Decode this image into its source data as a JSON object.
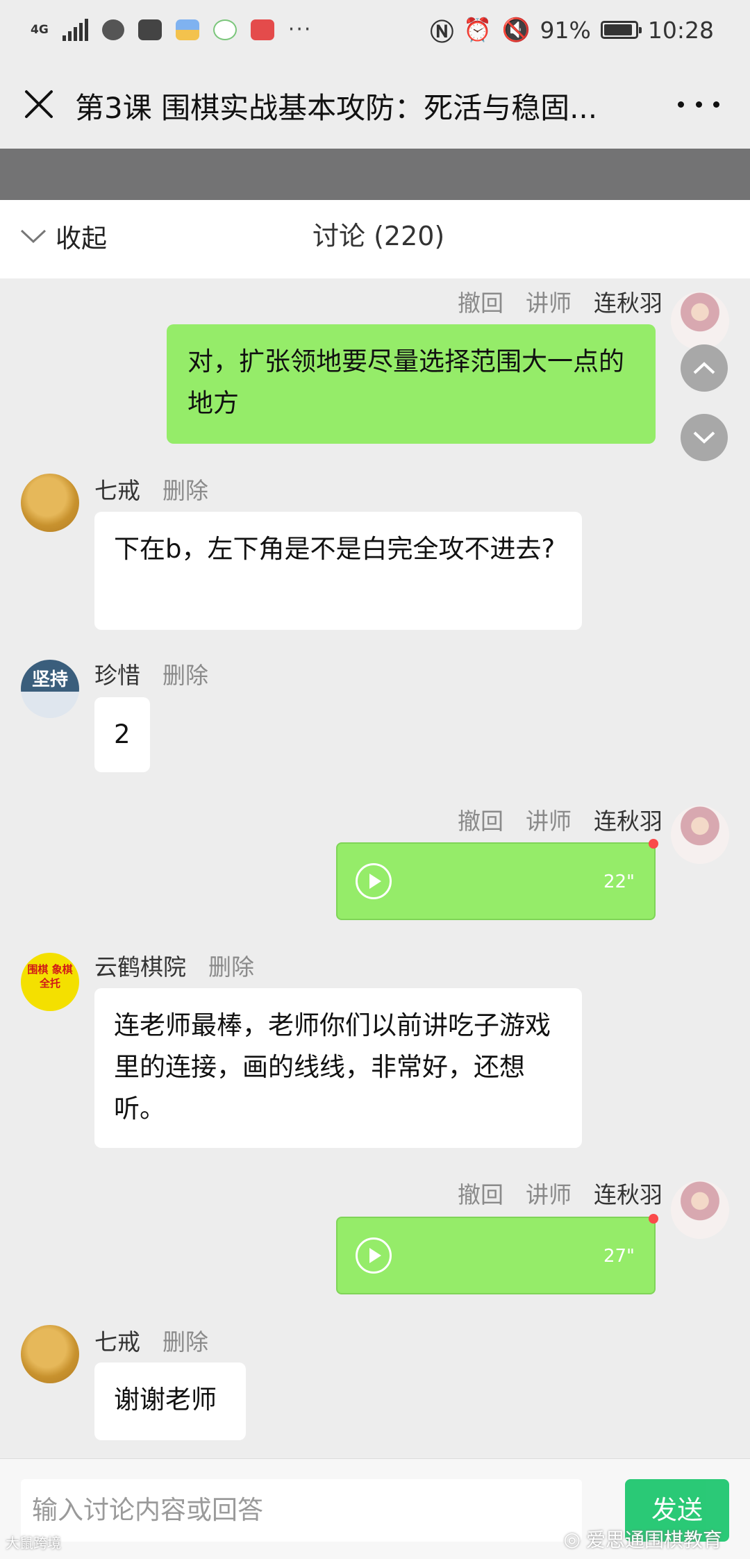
{
  "status_bar": {
    "network": "4G",
    "battery": "91%",
    "battery_level": 0.91,
    "time": "10:28"
  },
  "header": {
    "title": "第3课 围棋实战基本攻防：死活与稳固...",
    "icons": [
      "close-icon",
      "more-icon"
    ]
  },
  "discussion": {
    "collapse_label": "收起",
    "title": "讨论 (220)"
  },
  "messages": [
    {
      "action": "撤回",
      "role": "讲师",
      "name": "连秋羽",
      "text": "对，扩张领地要尽量选择范围大一点的地方"
    },
    {
      "name": "七戒",
      "action": "删除",
      "text": "下在b，左下角是不是白完全攻不进去?"
    },
    {
      "name": "珍惜",
      "action": "删除",
      "text": "2",
      "avatar_text": "坚持"
    },
    {
      "action": "撤回",
      "role": "讲师",
      "name": "连秋羽",
      "duration": "22\""
    },
    {
      "name": "云鹤棋院",
      "action": "删除",
      "text": "连老师最棒，老师你们以前讲吃子游戏里的连接，画的线线，非常好，还想听。",
      "avatar_text": "围棋 象棋 全托"
    },
    {
      "action": "撤回",
      "role": "讲师",
      "name": "连秋羽",
      "duration": "27\""
    },
    {
      "name": "七戒",
      "action": "删除",
      "text": "谢谢老师"
    }
  ],
  "input": {
    "placeholder": "输入讨论内容或回答",
    "send_label": "发送"
  },
  "watermark": {
    "right": "爱思通围棋教育",
    "left": "大鼠跨境"
  },
  "colors": {
    "bubble_green": "#95ec69",
    "send_button": "#07c160",
    "unread_dot": "#fa4a4a"
  }
}
